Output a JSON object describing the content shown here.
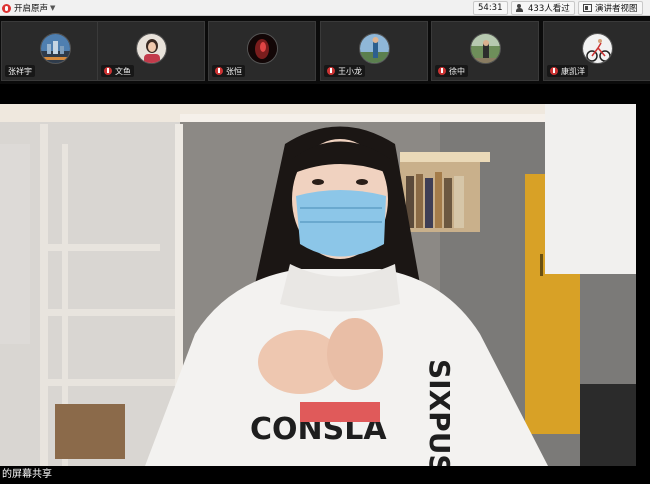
{
  "toolbar": {
    "mic_label": "开启原声",
    "timer": "54:31",
    "viewers": "433人看过",
    "view_mode": "演讲者视图"
  },
  "participants": [
    {
      "name": "张祥宇"
    },
    {
      "name": "文鱼"
    },
    {
      "name": "张恒"
    },
    {
      "name": "王小龙"
    },
    {
      "name": "徐中"
    },
    {
      "name": "康凯洋"
    }
  ],
  "main_view": {
    "caption": "的屏幕共享"
  },
  "colors": {
    "toolbar_bg": "#f1f1f1",
    "strip_bg": "#0b0b0b",
    "tile_bg": "#2a2a2a",
    "mute_red": "#cc3333"
  }
}
